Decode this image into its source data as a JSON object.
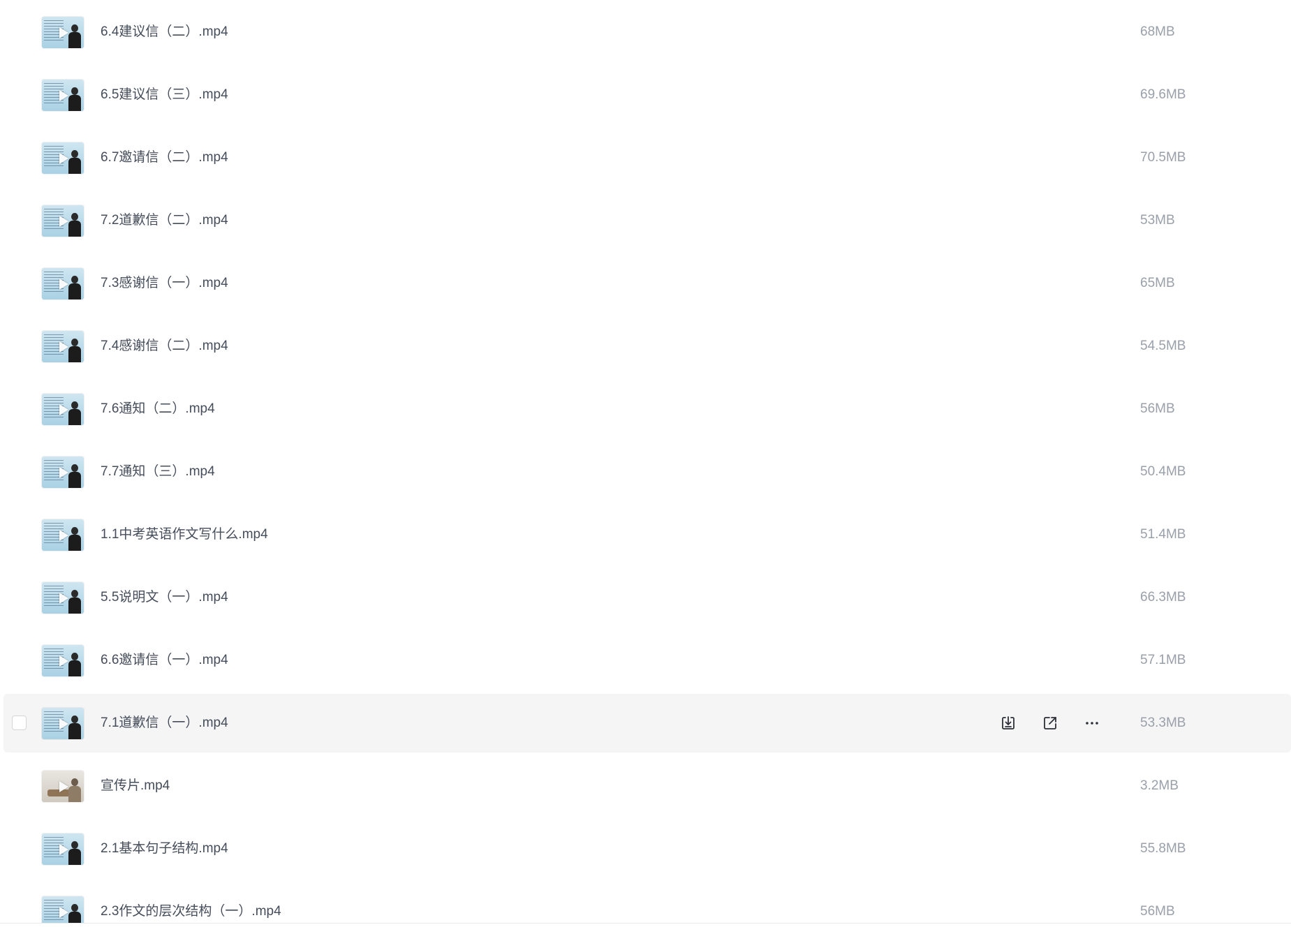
{
  "files": [
    {
      "name": "6.4建议信（二）.mp4",
      "size": "68MB",
      "thumb": "lecture"
    },
    {
      "name": "6.5建议信（三）.mp4",
      "size": "69.6MB",
      "thumb": "lecture"
    },
    {
      "name": "6.7邀请信（二）.mp4",
      "size": "70.5MB",
      "thumb": "lecture"
    },
    {
      "name": "7.2道歉信（二）.mp4",
      "size": "53MB",
      "thumb": "lecture"
    },
    {
      "name": "7.3感谢信（一）.mp4",
      "size": "65MB",
      "thumb": "lecture"
    },
    {
      "name": "7.4感谢信（二）.mp4",
      "size": "54.5MB",
      "thumb": "lecture"
    },
    {
      "name": "7.6通知（二）.mp4",
      "size": "56MB",
      "thumb": "lecture"
    },
    {
      "name": "7.7通知（三）.mp4",
      "size": "50.4MB",
      "thumb": "lecture"
    },
    {
      "name": "1.1中考英语作文写什么.mp4",
      "size": "51.4MB",
      "thumb": "lecture"
    },
    {
      "name": "5.5说明文（一）.mp4",
      "size": "66.3MB",
      "thumb": "lecture"
    },
    {
      "name": "6.6邀请信（一）.mp4",
      "size": "57.1MB",
      "thumb": "lecture"
    },
    {
      "name": "7.1道歉信（一）.mp4",
      "size": "53.3MB",
      "thumb": "lecture",
      "hovered": true
    },
    {
      "name": "宣传片.mp4",
      "size": "3.2MB",
      "thumb": "promo"
    },
    {
      "name": "2.1基本句子结构.mp4",
      "size": "55.8MB",
      "thumb": "lecture"
    },
    {
      "name": "2.3作文的层次结构（一）.mp4",
      "size": "56MB",
      "thumb": "lecture"
    }
  ],
  "row_actions": {
    "download_icon": "download-icon",
    "share_icon": "share-icon",
    "more_icon": "more-icon"
  },
  "colors": {
    "text": "#454d5a",
    "size_text": "#9aa0a9",
    "hover_bg": "#f5f5f6",
    "icon": "#2b2f36"
  }
}
